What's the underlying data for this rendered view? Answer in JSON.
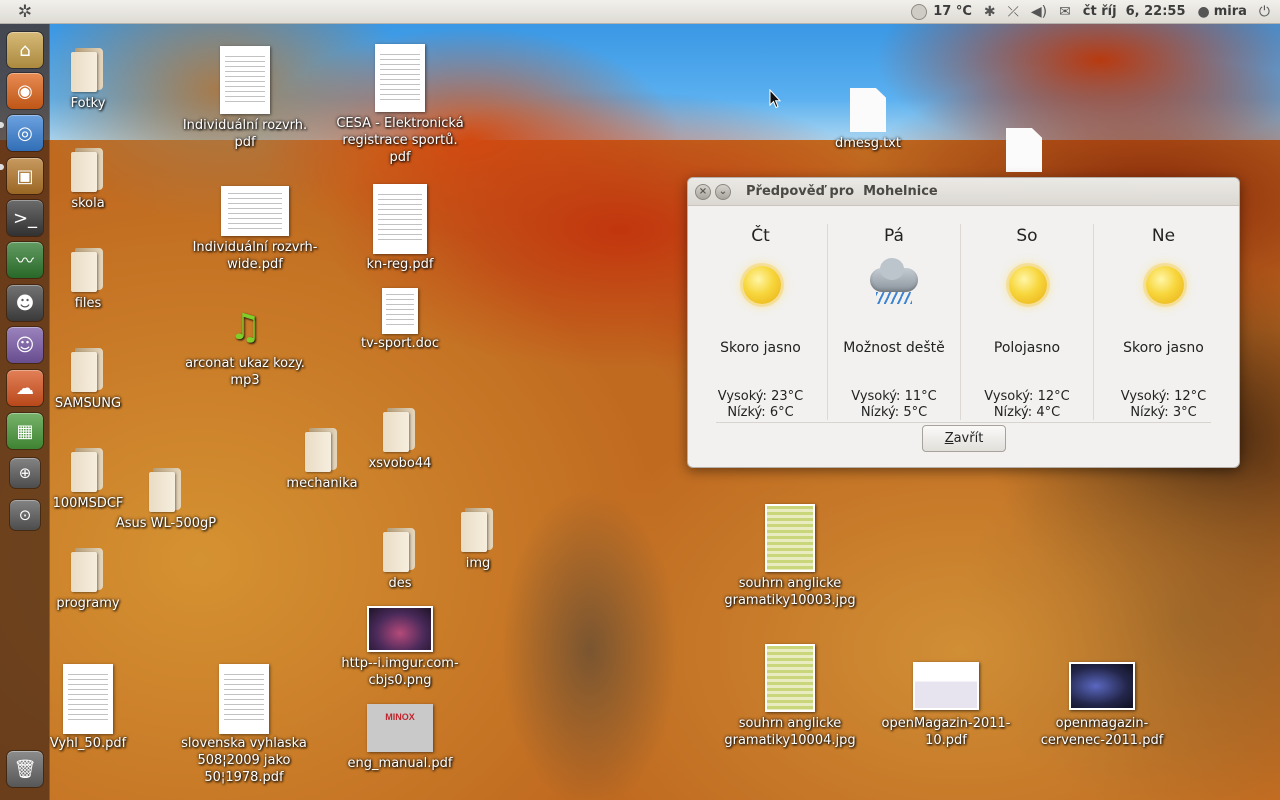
{
  "top_panel": {
    "temperature": "17 °C",
    "datetime": "čt říj  6, 22:55",
    "user": "mira"
  },
  "launcher": {
    "items": [
      {
        "icon": "home-folder-icon",
        "color": "#c9a24a"
      },
      {
        "icon": "firefox-icon",
        "color": "#e0651a"
      },
      {
        "icon": "chromium-icon",
        "color": "#3a82d6"
      },
      {
        "icon": "software-center-icon",
        "color": "#b5782a"
      },
      {
        "icon": "terminal-icon",
        "color": "#3a3a3a"
      },
      {
        "icon": "system-monitor-icon",
        "color": "#2f7a2f"
      },
      {
        "icon": "pidgin-penguin-icon",
        "color": "#444"
      },
      {
        "icon": "empathy-icon",
        "color": "#7a5aa8"
      },
      {
        "icon": "ubuntu-one-icon",
        "color": "#d9551f"
      },
      {
        "icon": "spreadsheet-icon",
        "color": "#4a9a3a"
      },
      {
        "icon": "magnifier-icon",
        "color": "#5a5a5a"
      },
      {
        "icon": "search-files-icon",
        "color": "#5a5a5a"
      },
      {
        "icon": "trash-icon",
        "color": "#666"
      }
    ]
  },
  "desktop_icons": [
    {
      "label": "Fotky",
      "kind": "folder"
    },
    {
      "label": "skola",
      "kind": "folder"
    },
    {
      "label": "files",
      "kind": "folder"
    },
    {
      "label": "SAMSUNG",
      "kind": "folder"
    },
    {
      "label": "100MSDCF",
      "kind": "folder"
    },
    {
      "label": "programy",
      "kind": "folder"
    },
    {
      "label": "Asus WL-500gP",
      "kind": "folder"
    },
    {
      "label": "Individuální rozvrh.\npdf",
      "kind": "pdf"
    },
    {
      "label": "Individuální rozvrh-\nwide.pdf",
      "kind": "pdf"
    },
    {
      "label": "arconat ukaz kozy.\nmp3",
      "kind": "audio"
    },
    {
      "label": "CESA - Elektronická\nregistrace sportů.\npdf",
      "kind": "pdf"
    },
    {
      "label": "kn-reg.pdf",
      "kind": "pdf"
    },
    {
      "label": "tv-sport.doc",
      "kind": "doc"
    },
    {
      "label": "mechanika",
      "kind": "folder"
    },
    {
      "label": "xsvobo44",
      "kind": "folder"
    },
    {
      "label": "des",
      "kind": "folder"
    },
    {
      "label": "img",
      "kind": "folder"
    },
    {
      "label": "http--i.imgur.com-\ncbjs0.png",
      "kind": "image"
    },
    {
      "label": "eng_manual.pdf",
      "kind": "pdf"
    },
    {
      "label": "Vyhl_50.pdf",
      "kind": "pdf"
    },
    {
      "label": "slovenska vyhlaska\n508¦2009 jako\n50¦1978.pdf",
      "kind": "pdf"
    },
    {
      "label": "dmesg.txt",
      "kind": "text"
    },
    {
      "label": "",
      "kind": "text"
    },
    {
      "label": "souhrn anglicke\ngramatiky10003.jpg",
      "kind": "image"
    },
    {
      "label": "souhrn anglicke\ngramatiky10004.jpg",
      "kind": "image"
    },
    {
      "label": "openMagazin-2011-\n10.pdf",
      "kind": "pdf"
    },
    {
      "label": "openmagazin-\ncervenec-2011.pdf",
      "kind": "pdf"
    }
  ],
  "forecast": {
    "title": "Předpověď pro  Mohelnice",
    "close_label": "Zavřít",
    "days": [
      {
        "name": "Čt",
        "condition": "Skoro jasno",
        "icon": "sun-icon",
        "high": "Vysoký: 23°C",
        "low": "Nízký: 6°C"
      },
      {
        "name": "Pá",
        "condition": "Možnost deště",
        "icon": "rain-cloud-icon",
        "high": "Vysoký: 11°C",
        "low": "Nízký: 5°C"
      },
      {
        "name": "So",
        "condition": "Polojasno",
        "icon": "sun-icon",
        "high": "Vysoký: 12°C",
        "low": "Nízký: 4°C"
      },
      {
        "name": "Ne",
        "condition": "Skoro jasno",
        "icon": "sun-icon",
        "high": "Vysoký: 12°C",
        "low": "Nízký: 3°C"
      }
    ]
  }
}
